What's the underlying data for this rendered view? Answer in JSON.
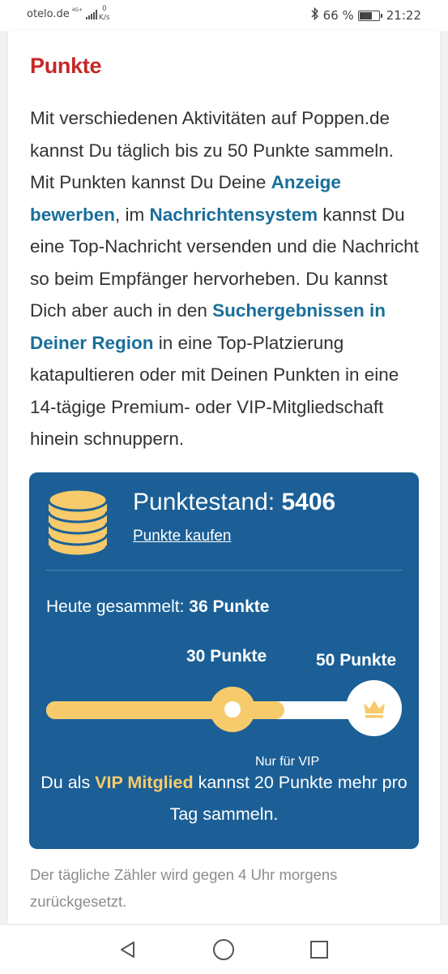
{
  "status_bar": {
    "carrier": "otelo.de",
    "network": "4G+",
    "speed_value": "0",
    "speed_unit": "K/s",
    "battery_percent": "66 %",
    "battery_level": 0.66,
    "time": "21:22"
  },
  "section": {
    "title": "Punkte",
    "paragraph": {
      "t1": "Mit verschiedenen Aktivitäten auf Poppen.de kannst Du täglich bis zu 50 Punkte sammeln. Mit Punkten kannst Du Deine ",
      "link1": "Anzeige bewerben",
      "t2": ", im ",
      "link2": "Nachrichtensystem",
      "t3": " kannst Du eine Top-Nachricht versenden und die Nachricht so beim Empfänger hervorheben. Du kannst Dich aber auch in den ",
      "link3": "Suchergebnissen in Deiner Region",
      "t4": " in eine Top-Platzierung katapultieren oder mit Deinen Punkten in eine 14-tägige Premium- oder VIP-Mitgliedschaft hinein schnuppern."
    }
  },
  "points_box": {
    "balance_label": "Punktestand:",
    "balance_value": "5406",
    "buy_link": "Punkte kaufen",
    "today_label": "Heute gesammelt:",
    "today_value": "36 Punkte",
    "limit_regular": "30 Punkte",
    "limit_vip": "50 Punkte",
    "progress_value": 36,
    "progress_max": 50,
    "vip_only_label": "Nur für VIP",
    "vip_text_1": "Du als ",
    "vip_highlight": "VIP Mitglied",
    "vip_text_2": " kannst 20 Punkte mehr pro Tag sammeln.",
    "coins_icon": "coin-stack-icon",
    "crown_icon": "crown-icon"
  },
  "footnote": "Der tägliche Zähler wird gegen 4 Uhr morgens zurückgesetzt.",
  "colors": {
    "title_red": "#c62828",
    "link_blue": "#1a6e9a",
    "box_blue": "#1b5f96",
    "gold": "#f7cb6b"
  },
  "nav": {
    "back_icon": "back-triangle-icon",
    "home_icon": "home-circle-icon",
    "recents_icon": "recents-square-icon"
  }
}
